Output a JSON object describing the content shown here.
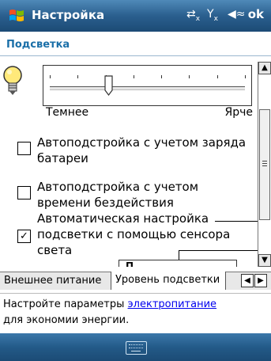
{
  "titlebar": {
    "title": "Настройка",
    "ok_label": "ok",
    "icons": [
      "start-windows-icon",
      "connectivity-icon",
      "signal-off-icon",
      "volume-icon"
    ],
    "background": "#2a5f8e"
  },
  "section": {
    "title": "Подсветка",
    "title_color": "#1a6fa8"
  },
  "slider": {
    "dim_label": "Темнее",
    "bright_label": "Ярче",
    "level": 0.3,
    "tick_count": 8
  },
  "options": [
    {
      "label": "Автоподстройка с учетом заряда батареи",
      "checked": false
    },
    {
      "label": "Автоподстройка с учетом времени бездействия",
      "checked": false
    },
    {
      "label": "Автоматическая настройка подсветки с помощью сенсора света",
      "checked": true
    }
  ],
  "popup": {
    "text": "П"
  },
  "tabs": [
    {
      "label": "Внешнее питание",
      "active": false
    },
    {
      "label": "Уровень подсветки",
      "active": true
    }
  ],
  "help": {
    "text_before": "Настройте параметры ",
    "link": "электропитание",
    "text_after": "для экономии энергии."
  },
  "bottombar": {
    "icon": "keyboard-icon"
  },
  "colors": {
    "link": "#0000ee",
    "accent": "#1a6fa8"
  }
}
